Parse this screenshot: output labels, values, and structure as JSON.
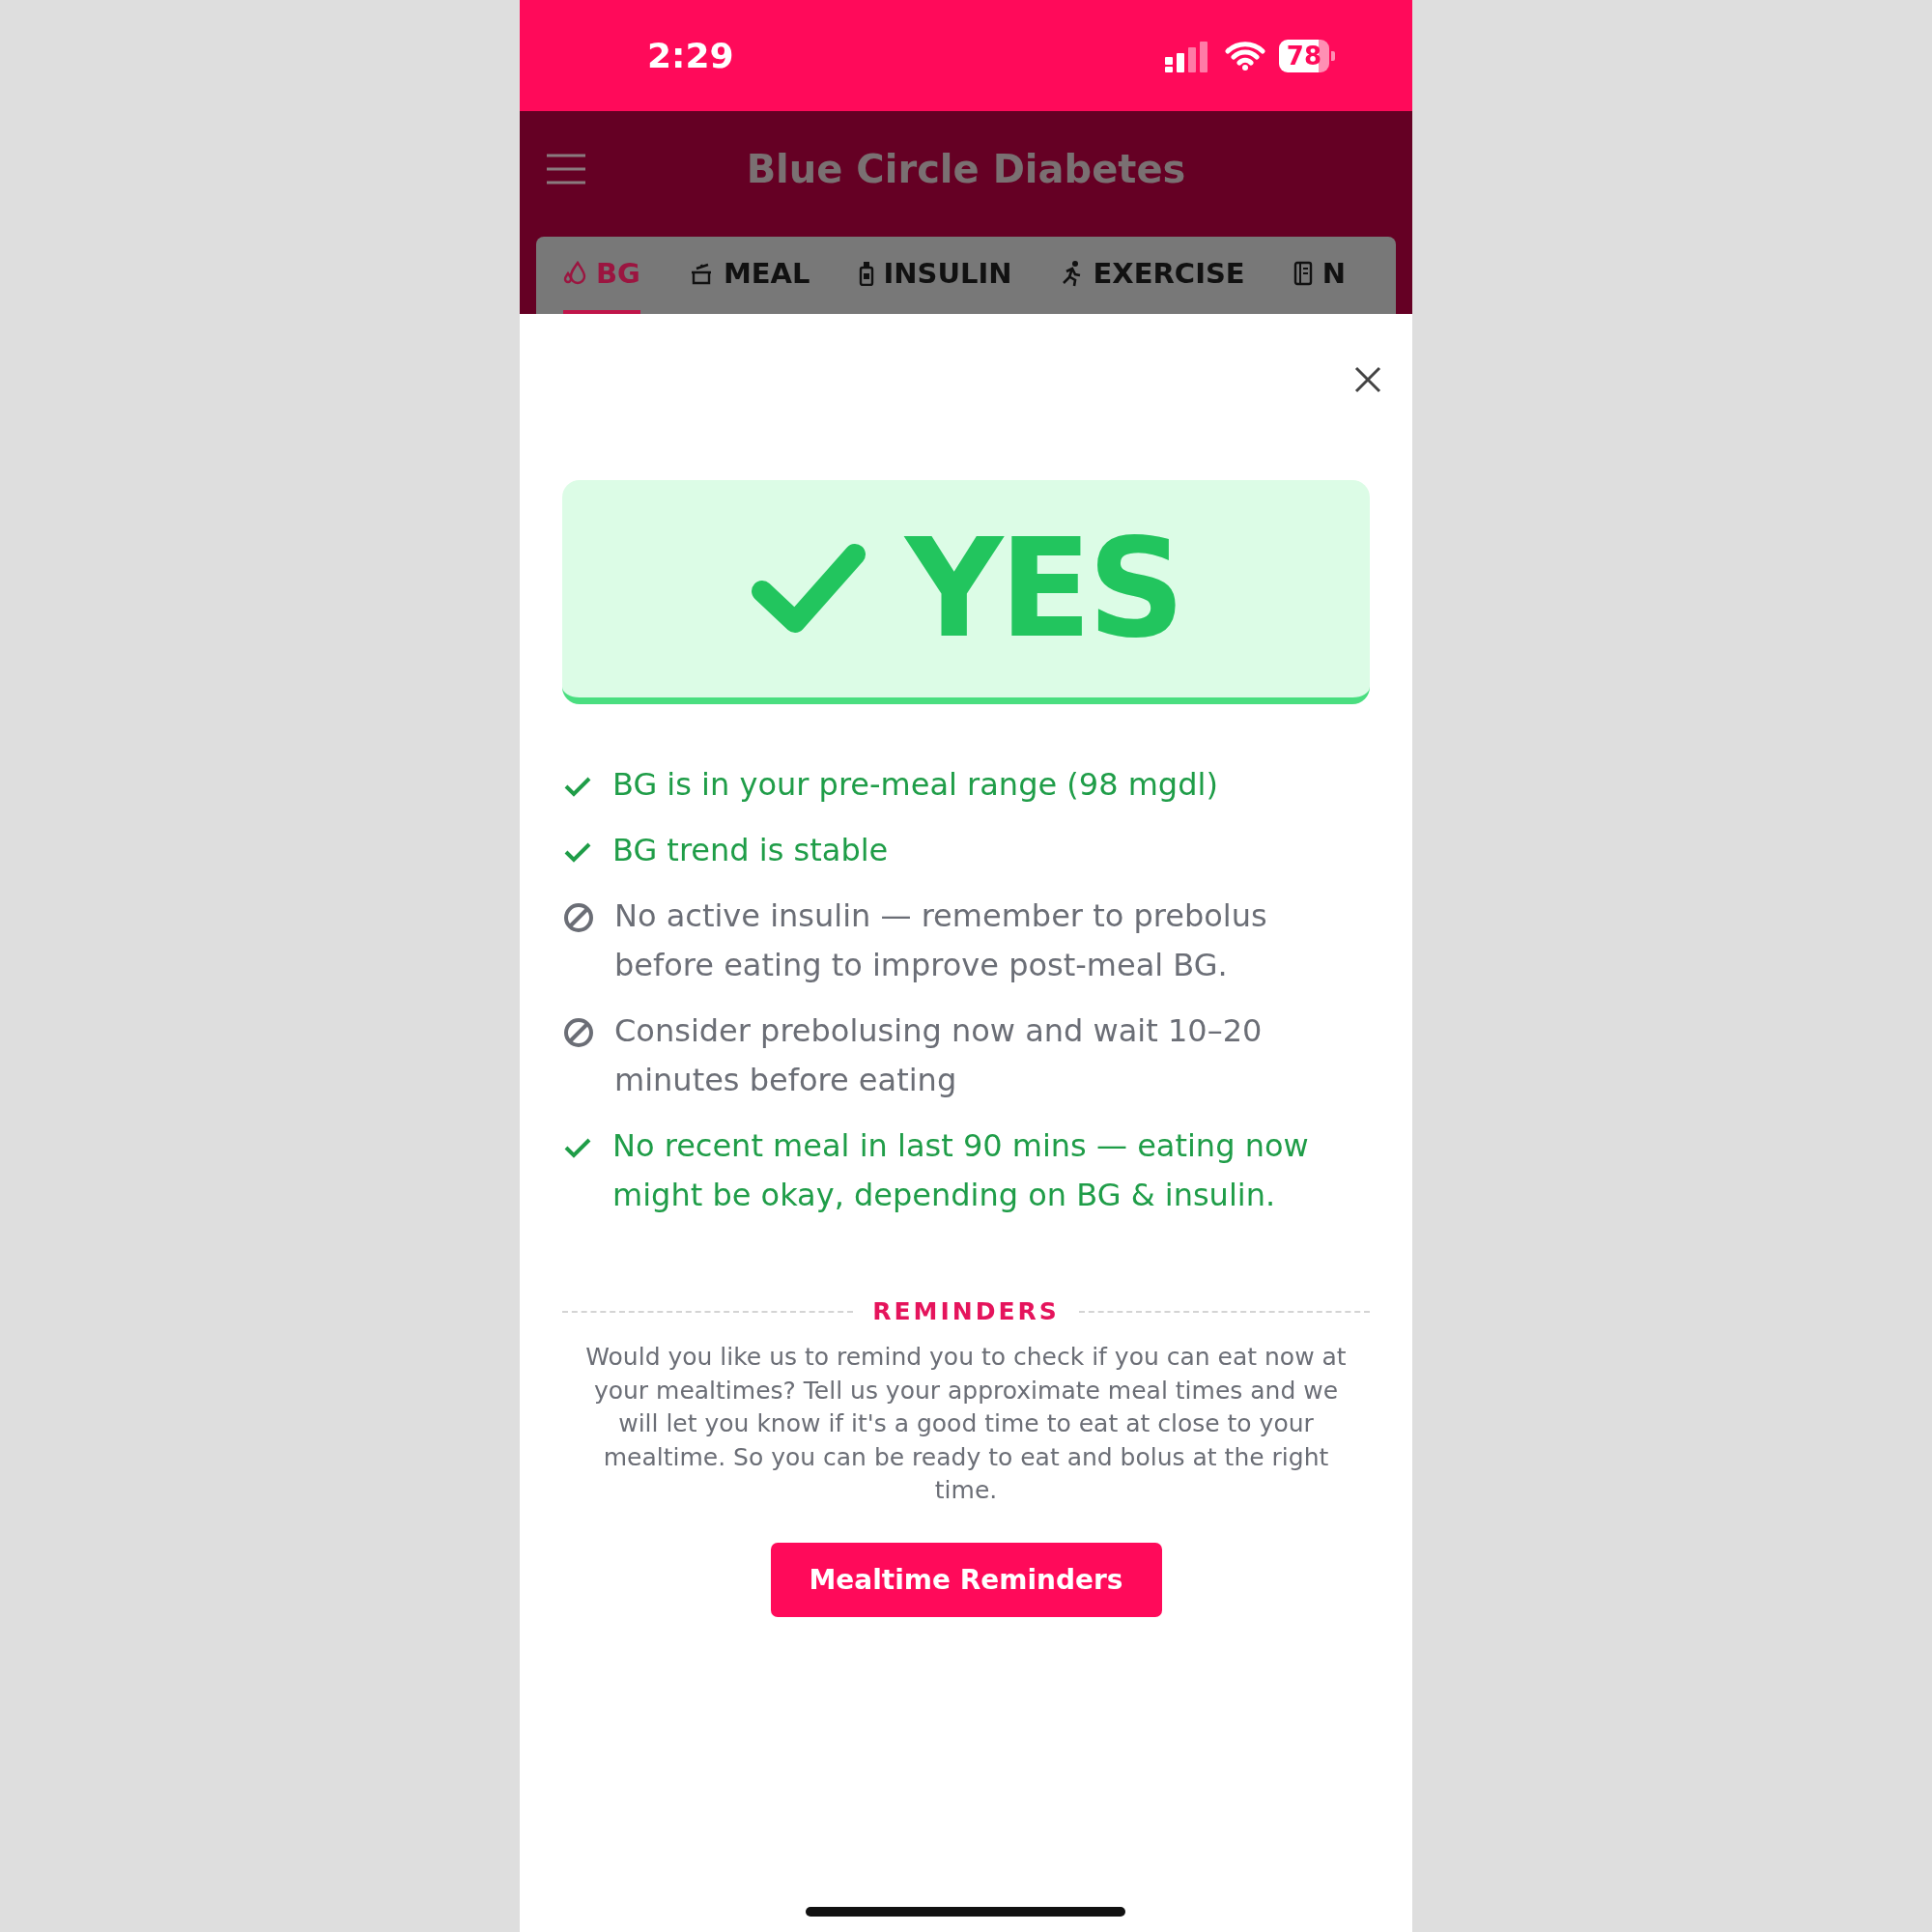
{
  "status_bar": {
    "time": "2:29",
    "battery": "78"
  },
  "header": {
    "title": "Blue Circle Diabetes"
  },
  "tabs": [
    {
      "label": "BG",
      "kind": "drop",
      "selected": true
    },
    {
      "label": "MEAL",
      "kind": "pot",
      "selected": false
    },
    {
      "label": "INSULIN",
      "kind": "bottle",
      "selected": false
    },
    {
      "label": "EXERCISE",
      "kind": "runner",
      "selected": false
    },
    {
      "label": "N",
      "kind": "notebook",
      "selected": false
    }
  ],
  "verdict": {
    "kind": "yes",
    "text": "YES"
  },
  "checks": [
    {
      "kind": "pass",
      "text": "BG is in your pre-meal range (98 mgdl)"
    },
    {
      "kind": "pass",
      "text": "BG trend is stable"
    },
    {
      "kind": "blocked",
      "text": "No active insulin — remember to prebolus before eating to improve post-meal BG."
    },
    {
      "kind": "blocked",
      "text": "Consider prebolusing now and wait 10–20 minutes before eating"
    },
    {
      "kind": "pass",
      "text": "No recent meal in last 90 mins — eating now might be okay, depending on BG & insulin."
    }
  ],
  "reminders": {
    "heading": "REMINDERS",
    "text": "Would you like us to remind you to check if you can eat now at your mealtimes? Tell us your approximate meal times and we will let you know if it's a good time to eat at close to your mealtime. So you can be ready to eat and bolus at the right time.",
    "button": "Mealtime Reminders"
  }
}
